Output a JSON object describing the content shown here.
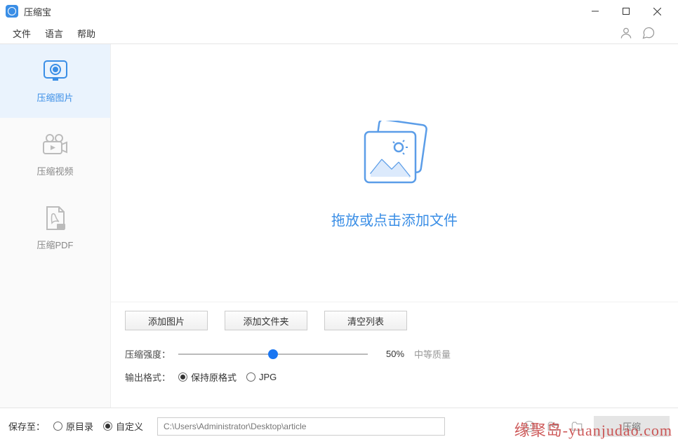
{
  "window": {
    "title": "压缩宝"
  },
  "menu": {
    "file": "文件",
    "language": "语言",
    "help": "帮助"
  },
  "sidebar": {
    "compress_image": "压缩图片",
    "compress_video": "压缩视频",
    "compress_pdf": "压缩PDF"
  },
  "dropzone": {
    "text": "拖放或点击添加文件"
  },
  "buttons": {
    "add_image": "添加图片",
    "add_folder": "添加文件夹",
    "clear_list": "清空列表",
    "compress": "压缩"
  },
  "settings": {
    "strength_label": "压缩强度：",
    "strength_value": 50,
    "strength_percent": "50%",
    "quality_text": "中等质量",
    "output_format_label": "输出格式：",
    "format_keep": "保持原格式",
    "format_jpg": "JPG"
  },
  "save": {
    "label": "保存至：",
    "option_original": "原目录",
    "option_custom": "自定义",
    "path": "C:\\Users\\Administrator\\Desktop\\article"
  },
  "watermark": "缘聚岛-yuanjudao.com"
}
